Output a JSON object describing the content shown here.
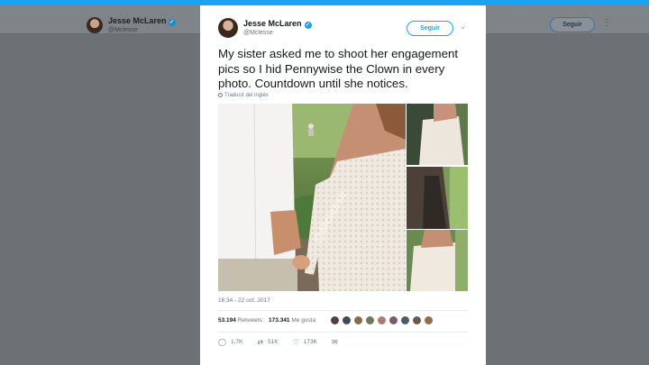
{
  "background_header": {
    "name": "Jesse McLaren",
    "handle": "@Mclesse",
    "follow_label": "Seguir",
    "more_glyph": "⋮"
  },
  "tweet": {
    "name": "Jesse McLaren",
    "handle": "@Mclesse",
    "follow_label": "Seguir",
    "verified_glyph": "✓",
    "chevron_glyph": "⌄",
    "text": "My sister asked me to shoot her engagement pics so I hid Pennywise the Clown in every photo. Countdown until she notices.",
    "translate_label": "Traducir del inglés",
    "watermark": "@Mclesse",
    "timestamp": "16:34 - 22 oct. 2017",
    "retweets_count": "53.194",
    "retweets_label": "Retweets",
    "likes_count": "173.341",
    "likes_label": "Me gusta",
    "liker_colors": [
      "#5a3b4a",
      "#3e4a5a",
      "#8a6a4a",
      "#6a7a5a",
      "#b07a70",
      "#7a5a6a",
      "#4a5a6a",
      "#6a5a4a",
      "#9a6a4a"
    ],
    "actions": {
      "reply": {
        "icon": "reply-icon",
        "glyph": "◯",
        "count": "1,7K"
      },
      "retweet": {
        "icon": "retweet-icon",
        "glyph": "⇄",
        "count": "51K"
      },
      "like": {
        "icon": "heart-icon",
        "glyph": "♡",
        "count": "173K"
      },
      "message": {
        "icon": "envelope-icon",
        "glyph": "✉"
      }
    }
  },
  "colors": {
    "accent": "#1da1f2",
    "overlay": "#6c7176"
  }
}
